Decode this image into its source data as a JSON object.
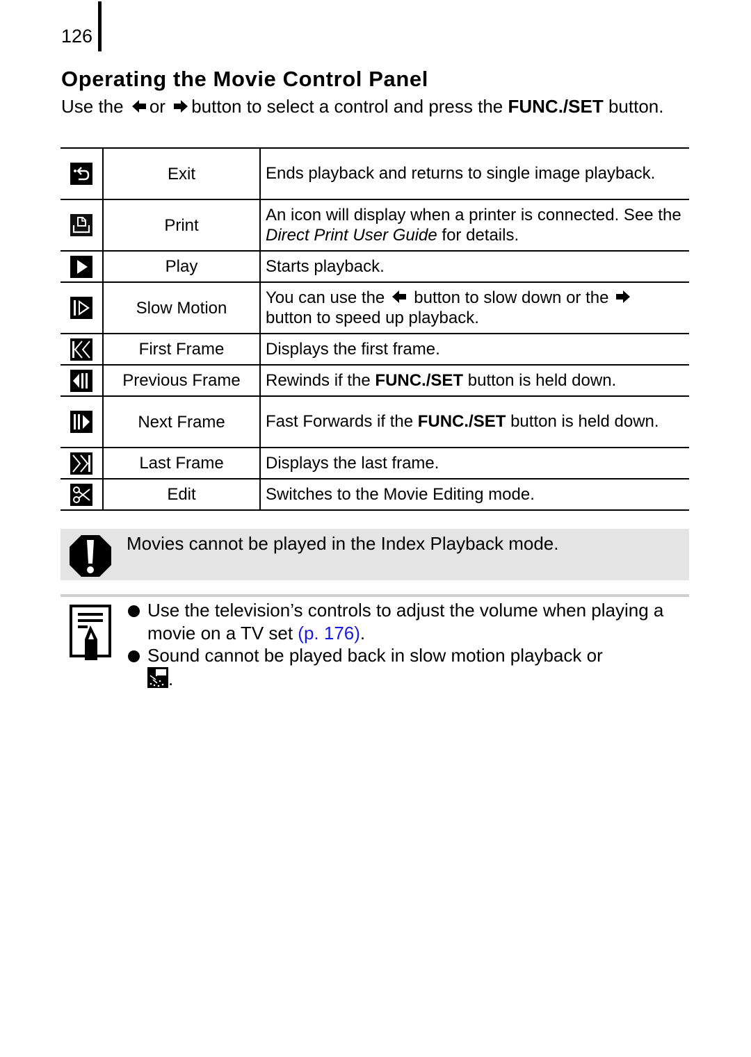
{
  "page": {
    "number": "126",
    "title": "Operating the Movie Control Panel",
    "intro": {
      "part1": "Use the",
      "left_arrow_icon": "left-arrow-icon",
      "part2": "or",
      "right_arrow_icon": "right-arrow-icon",
      "part3": "button to select a control and press the",
      "bold": "FUNC./SET",
      "part4": "button."
    }
  },
  "controls": [
    {
      "icon": "exit-icon",
      "name": "Exit",
      "desc": "Ends playback and returns to single image playback."
    },
    {
      "icon": "print-icon",
      "name": "Print",
      "desc_pre": "An icon will display when a printer is connected. See the ",
      "desc_italic": "Direct Print User Guide",
      "desc_post": " for details."
    },
    {
      "icon": "play-icon",
      "name": "Play",
      "desc": "Starts playback."
    },
    {
      "icon": "slow-motion-icon",
      "name": "Slow Motion",
      "desc_pre": "You can use the",
      "desc_mid": "button to slow down or the",
      "desc_post": "button to speed up playback."
    },
    {
      "icon": "first-frame-icon",
      "name": "First Frame",
      "desc": "Displays the first frame."
    },
    {
      "icon": "previous-frame-icon",
      "name": "Previous Frame",
      "desc_pre": "Rewinds if the ",
      "desc_bold": "FUNC./SET",
      "desc_post": " button is held down."
    },
    {
      "icon": "next-frame-icon",
      "name": "Next Frame",
      "desc_pre": "Fast Forwards if the ",
      "desc_bold": "FUNC./SET",
      "desc_post": " button is held down."
    },
    {
      "icon": "last-frame-icon",
      "name": "Last Frame",
      "desc": "Displays the last frame."
    },
    {
      "icon": "edit-icon",
      "name": "Edit",
      "desc": "Switches to the Movie Editing mode."
    }
  ],
  "caution": {
    "icon": "caution-icon",
    "text": "Movies cannot be played in the Index Playback mode."
  },
  "notes": {
    "icon": "note-icon",
    "items": [
      {
        "text_pre": "Use the television’s controls to adjust the volume when playing a movie on a TV set ",
        "link": "(p. 176)",
        "text_post": "."
      },
      {
        "text_pre": "Sound cannot be played back in slow motion playback or ",
        "icon": "mode-icon",
        "text_post": "."
      }
    ]
  },
  "colors": {
    "caution_bg": "#e4e4e4",
    "link": "#1a1adc",
    "rule": "#cfcfcf"
  }
}
